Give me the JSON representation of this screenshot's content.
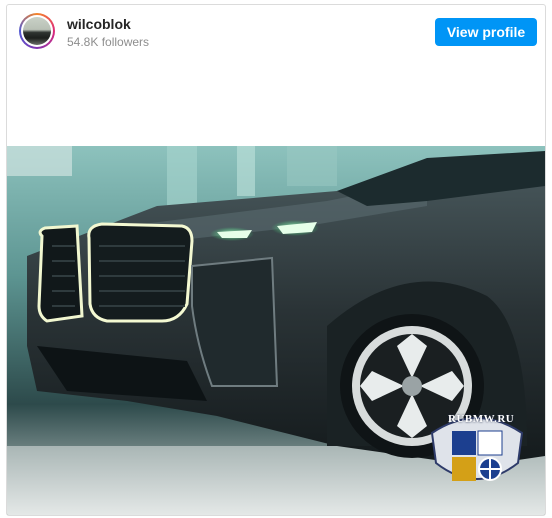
{
  "header": {
    "username": "wilcoblok",
    "followers": "54.8K followers",
    "view_profile_label": "View profile"
  },
  "photo": {
    "watermark_text": "RUBMW.RU",
    "subject": "car-photo"
  },
  "colors": {
    "button_bg": "#0095f6",
    "username": "#262626",
    "followers": "#8e8e8e",
    "border": "#dbdbdb"
  }
}
